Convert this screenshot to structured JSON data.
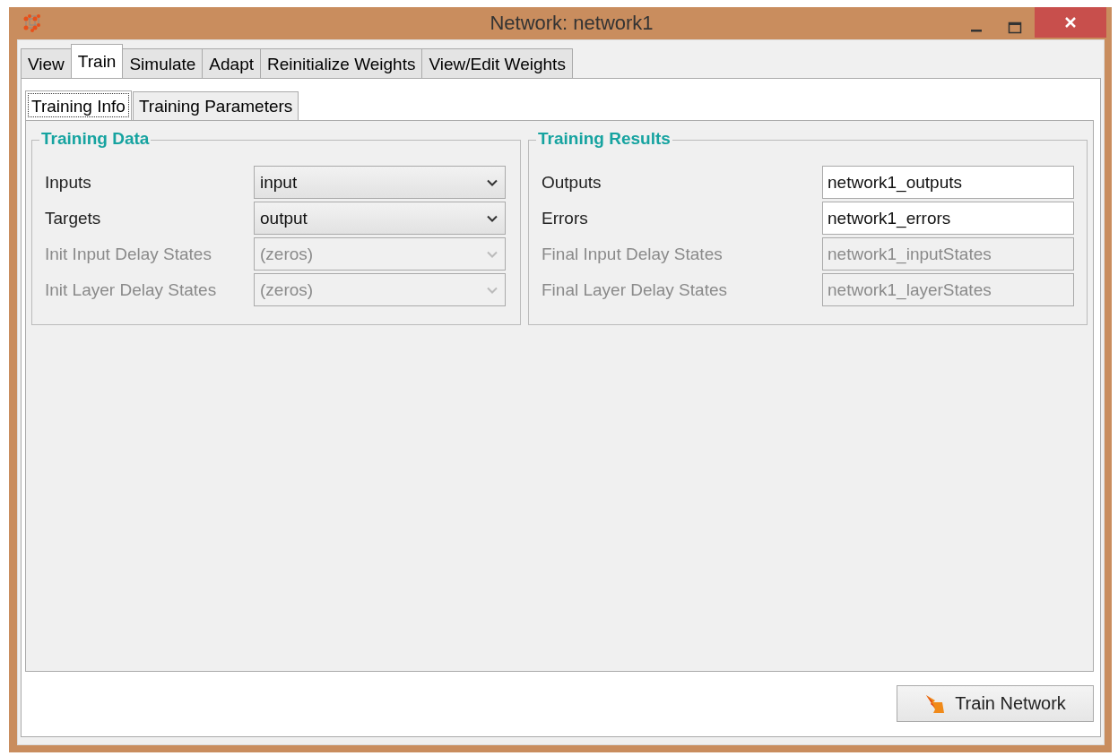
{
  "window": {
    "title": "Network: network1"
  },
  "tabs": [
    {
      "label": "View",
      "selected": false
    },
    {
      "label": "Train",
      "selected": true
    },
    {
      "label": "Simulate",
      "selected": false
    },
    {
      "label": "Adapt",
      "selected": false
    },
    {
      "label": "Reinitialize Weights",
      "selected": false
    },
    {
      "label": "View/Edit Weights",
      "selected": false
    }
  ],
  "subtabs": [
    {
      "label": "Training Info",
      "selected": true
    },
    {
      "label": "Training Parameters",
      "selected": false
    }
  ],
  "groups": [
    {
      "title": "Training Data",
      "rows": [
        {
          "label": "Inputs",
          "kind": "combo",
          "value": "input",
          "disabled": false
        },
        {
          "label": "Targets",
          "kind": "combo",
          "value": "output",
          "disabled": false
        },
        {
          "label": "Init Input Delay States",
          "kind": "combo",
          "value": "(zeros)",
          "disabled": true
        },
        {
          "label": "Init Layer Delay States",
          "kind": "combo",
          "value": "(zeros)",
          "disabled": true
        }
      ]
    },
    {
      "title": "Training Results",
      "rows": [
        {
          "label": "Outputs",
          "kind": "text",
          "value": "network1_outputs",
          "disabled": false
        },
        {
          "label": "Errors",
          "kind": "text",
          "value": "network1_errors",
          "disabled": false
        },
        {
          "label": "Final Input Delay States",
          "kind": "text",
          "value": "network1_inputStates",
          "disabled": true
        },
        {
          "label": "Final Layer Delay States",
          "kind": "text",
          "value": "network1_layerStates",
          "disabled": true
        }
      ]
    }
  ],
  "action_button": {
    "label": "Train Network"
  }
}
